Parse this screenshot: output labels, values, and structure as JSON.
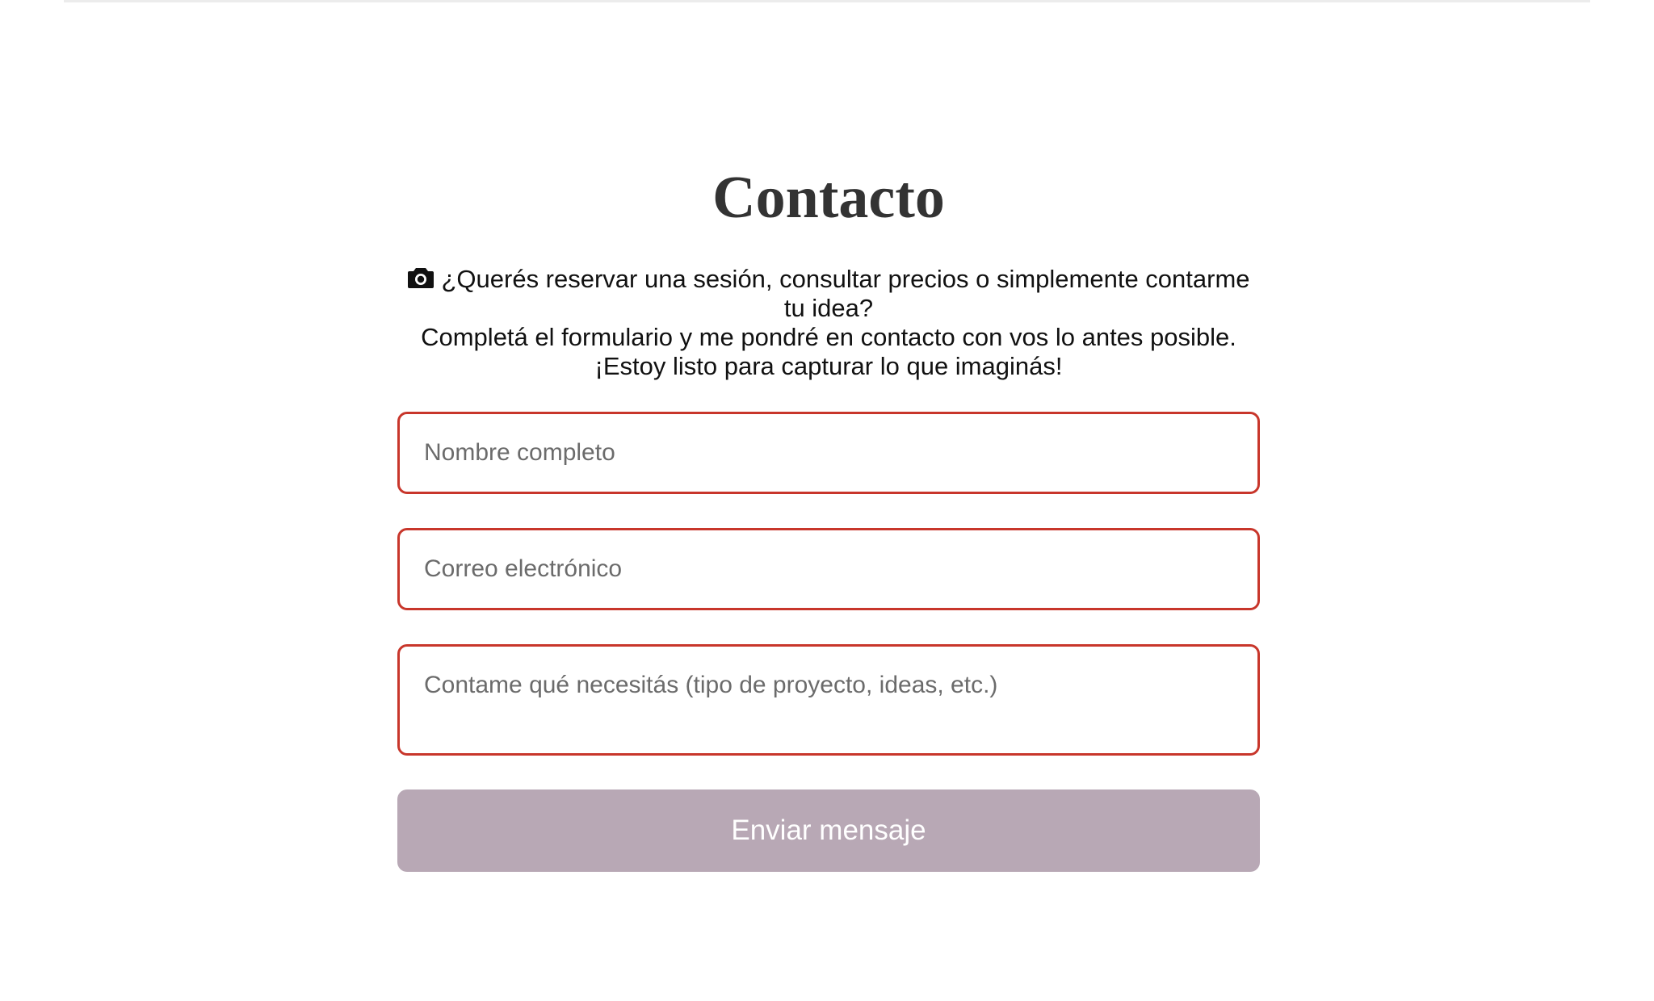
{
  "contact": {
    "title": "Contacto",
    "intro_line1": "¿Querés reservar una sesión, consultar precios o simplemente contarme tu idea?",
    "intro_line2": "Completá el formulario y me pondré en contacto con vos lo antes posible.",
    "intro_line3": "¡Estoy listo para capturar lo que imaginás!",
    "intro_icon": "camera-icon"
  },
  "form": {
    "name_placeholder": "Nombre completo",
    "email_placeholder": "Correo electrónico",
    "message_placeholder": "Contame qué necesitás (tipo de proyecto, ideas, etc.)",
    "submit_label": "Enviar mensaje"
  },
  "colors": {
    "field_border": "#c8362b",
    "button_background": "#b8a8b5",
    "title_color": "#333333"
  }
}
